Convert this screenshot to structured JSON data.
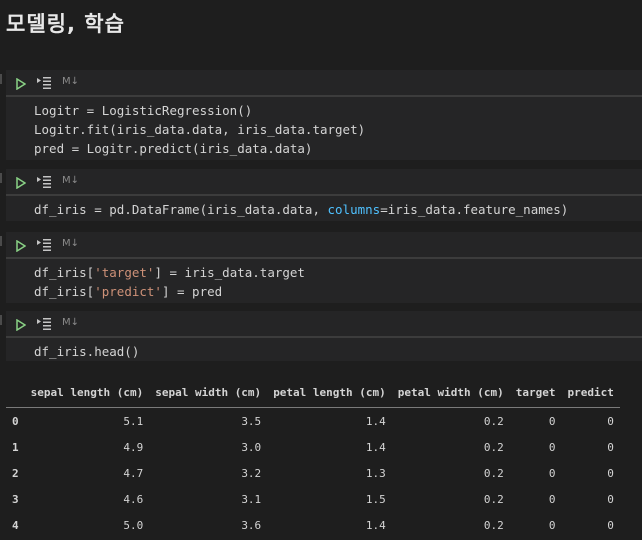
{
  "heading": "모델링, 학습",
  "cell_type_label": "M↓",
  "cells": [
    {
      "lines": [
        "Logitr = LogisticRegression()",
        "Logitr.fit(iris_data.data, iris_data.target)",
        "pred = Logitr.predict(iris_data.data)"
      ]
    },
    {
      "lines": [
        "df_iris = pd.DataFrame(iris_data.data, columns=iris_data.feature_names)"
      ]
    },
    {
      "lines": [
        "df_iris['target'] = iris_data.target",
        "df_iris['predict'] = pred"
      ]
    },
    {
      "lines": [
        "df_iris.head()"
      ]
    }
  ],
  "table": {
    "columns": [
      "",
      "sepal length (cm)",
      "sepal width (cm)",
      "petal length (cm)",
      "petal width (cm)",
      "target",
      "predict"
    ],
    "rows": [
      [
        "0",
        "5.1",
        "3.5",
        "1.4",
        "0.2",
        "0",
        "0"
      ],
      [
        "1",
        "4.9",
        "3.0",
        "1.4",
        "0.2",
        "0",
        "0"
      ],
      [
        "2",
        "4.7",
        "3.2",
        "1.3",
        "0.2",
        "0",
        "0"
      ],
      [
        "3",
        "4.6",
        "3.1",
        "1.5",
        "0.2",
        "0",
        "0"
      ],
      [
        "4",
        "5.0",
        "3.6",
        "1.4",
        "0.2",
        "0",
        "0"
      ]
    ]
  }
}
